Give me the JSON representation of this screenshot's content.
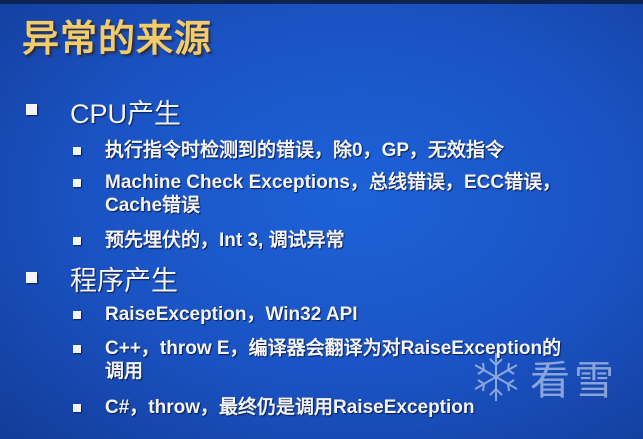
{
  "title": "异常的来源",
  "sections": [
    {
      "label": "CPU产生",
      "items": [
        "执行指令时检测到的错误，除0，GP，无效指令",
        "Machine Check Exceptions，总线错误，ECC错误，",
        "Cache错误",
        "预先埋伏的，Int 3, 调试异常"
      ]
    },
    {
      "label": "程序产生",
      "items": [
        "RaiseException，Win32 API",
        "C++，throw E，编译器会翻译为对RaiseException的",
        "调用",
        "C#，throw，最终仍是调用RaiseException"
      ]
    }
  ],
  "watermark": {
    "text": "看雪",
    "icon": "snowflake-icon"
  }
}
